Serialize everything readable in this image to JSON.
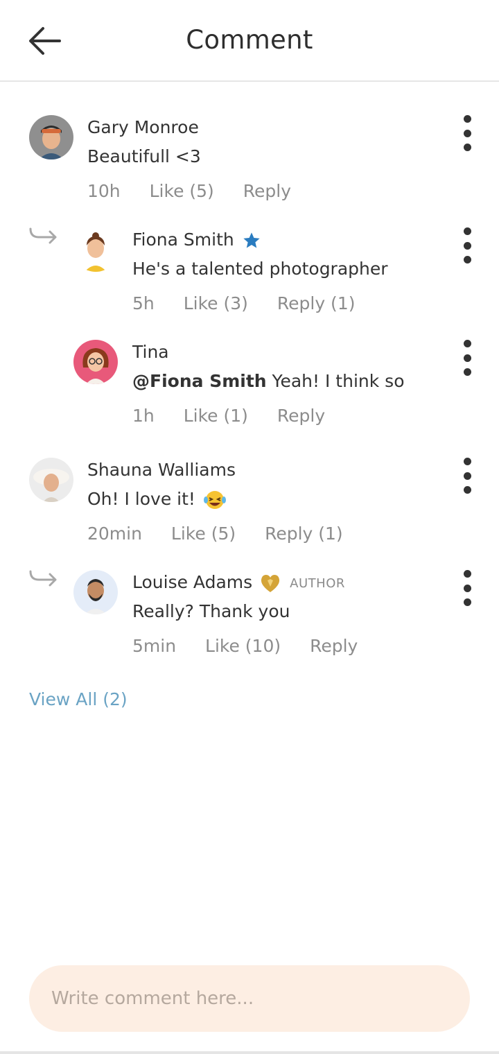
{
  "header": {
    "title": "Comment",
    "back_icon": "arrow-left-icon"
  },
  "comments": [
    {
      "name": "Gary Monroe",
      "text": "Beautifull <3",
      "time": "10h",
      "like": "Like (5)",
      "reply": "Reply",
      "avatar": "avatar-gary"
    },
    {
      "name": "Fiona Smith",
      "badge": "star-icon",
      "text": "He's a talented photographer",
      "time": "5h",
      "like": "Like (3)",
      "reply": "Reply (1)",
      "avatar": "avatar-fiona"
    },
    {
      "name": "Tina",
      "mention": "@Fiona Smith",
      "text": " Yeah! I think so",
      "time": "1h",
      "like": "Like (1)",
      "reply": "Reply",
      "avatar": "avatar-tina"
    },
    {
      "name": "Shauna Walliams",
      "text": "Oh! I love it!",
      "emoji": "laughing-emoji",
      "time": "20min",
      "like": "Like (5)",
      "reply": "Reply (1)",
      "avatar": "avatar-shauna"
    },
    {
      "name": "Louise Adams",
      "badge": "gold-heart-icon",
      "tag": "AUTHOR",
      "text": "Really? Thank you",
      "time": "5min",
      "like": "Like (10)",
      "reply": "Reply",
      "avatar": "avatar-louise"
    }
  ],
  "view_all": "View All (2)",
  "input": {
    "placeholder": "Write comment here..."
  },
  "colors": {
    "accent": "#6aa3c4",
    "input_bg": "#fdeee3",
    "star": "#2a7cc0",
    "gold": "#d4a437"
  }
}
